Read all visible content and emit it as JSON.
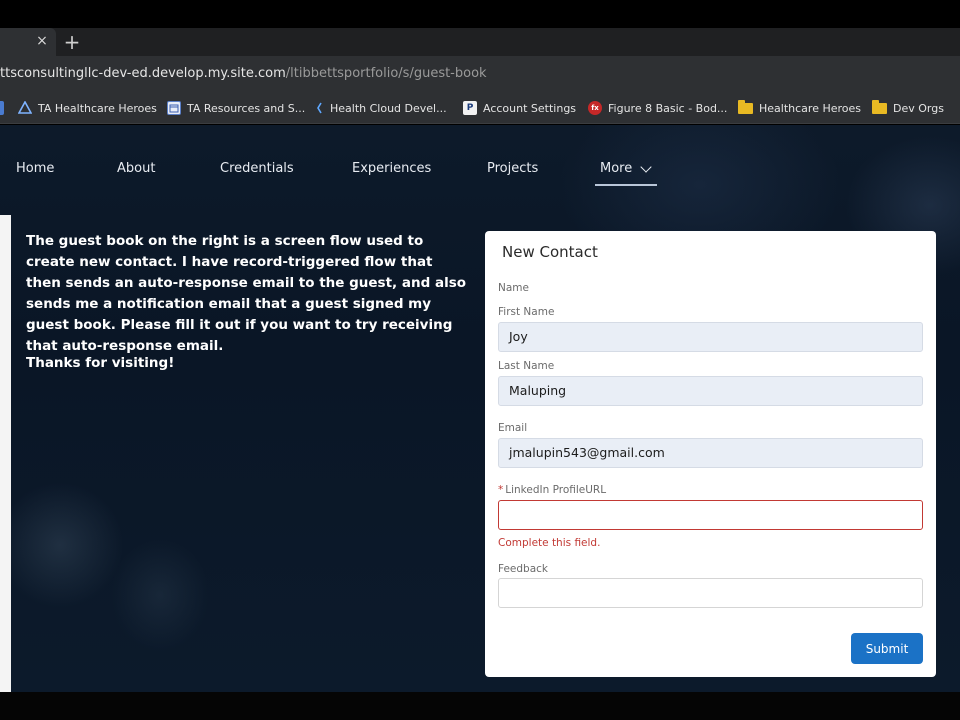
{
  "browser": {
    "url_host": "ttsconsultingllc-dev-ed.develop.my.site.com",
    "url_path": "/ltibbettsportfolio/s/guest-book",
    "tab_close": "×",
    "new_tab": "+",
    "bookmarks": [
      {
        "label": "TA Healthcare Heroes",
        "icon": "ta-icon"
      },
      {
        "label": "TA Resources and S...",
        "icon": "calendar-icon"
      },
      {
        "label": "Health Cloud Devel...",
        "icon": "salesforce-icon"
      },
      {
        "label": "Account Settings",
        "icon": "p-icon"
      },
      {
        "label": "Figure 8 Basic - Bod...",
        "icon": "fx-icon"
      },
      {
        "label": "Healthcare Heroes",
        "icon": "folder-icon"
      },
      {
        "label": "Dev Orgs",
        "icon": "folder-icon"
      }
    ]
  },
  "nav": {
    "items": [
      "Home",
      "About",
      "Credentials",
      "Experiences",
      "Projects",
      "More"
    ]
  },
  "intro": {
    "text": "The guest book on the right is a screen flow used to create new contact. I have record-triggered flow that then sends an auto-response email to the guest, and also sends me a notification email that a guest signed my guest book. Please fill it out if you want to try receiving that auto-response email.",
    "thanks": "Thanks for visiting!"
  },
  "form": {
    "title": "New Contact",
    "name_label": "Name",
    "first_name_label": "First Name",
    "first_name_value": "Joy",
    "last_name_label": "Last Name",
    "last_name_value": "Maluping",
    "email_label": "Email",
    "email_value": "jmalupin543@gmail.com",
    "linkedin_required_mark": "*",
    "linkedin_label": "LinkedIn ProfileURL",
    "linkedin_value": "",
    "linkedin_error": "Complete this field.",
    "feedback_label": "Feedback",
    "feedback_value": "",
    "submit_label": "Submit"
  },
  "colors": {
    "accent": "#1b72c6",
    "error": "#c23934",
    "site_bg": "#0a1626"
  }
}
